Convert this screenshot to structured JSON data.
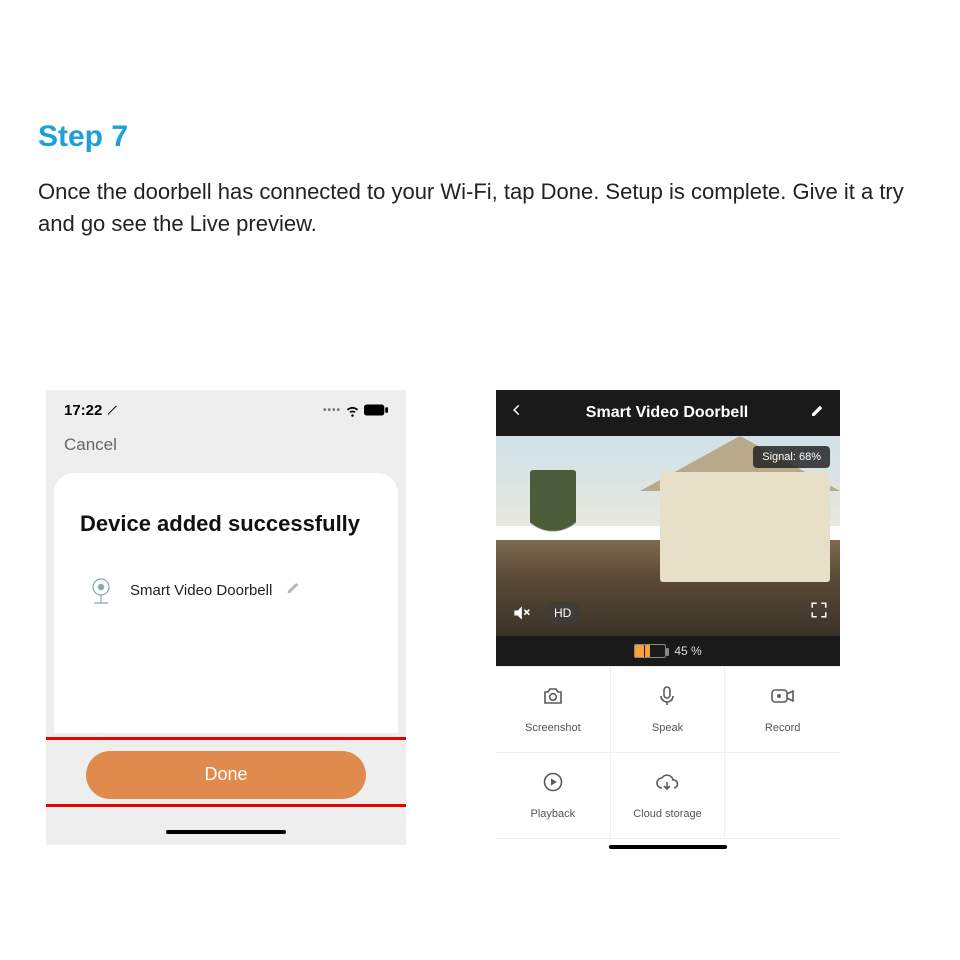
{
  "header": {
    "step_label": "Step 7",
    "description": "Once the doorbell has connected to your Wi-Fi, tap Done. Setup is complete. Give it a try and go see the Live preview."
  },
  "left_phone": {
    "status_time": "17:22",
    "cancel_label": "Cancel",
    "card_title": "Device added successfully",
    "device_name": "Smart Video Doorbell",
    "done_label": "Done"
  },
  "right_phone": {
    "header_title": "Smart Video Doorbell",
    "signal_label": "Signal: 68%",
    "hd_label": "HD",
    "battery_label": "45 %",
    "actions": {
      "screenshot": "Screenshot",
      "speak": "Speak",
      "record": "Record",
      "playback": "Playback",
      "cloud": "Cloud storage"
    }
  }
}
